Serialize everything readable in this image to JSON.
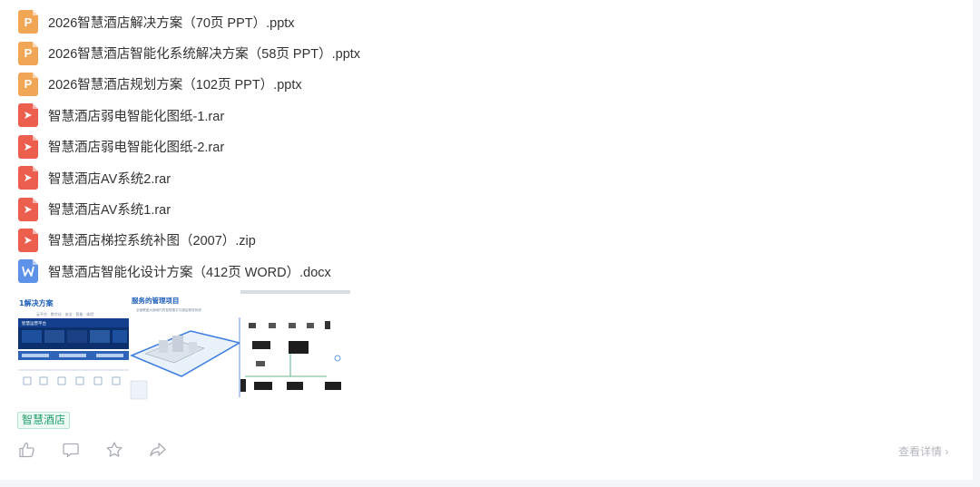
{
  "files": [
    {
      "name": "2026智慧酒店解决方案（70页 PPT）.pptx",
      "type": "ppt",
      "icon": "ppt-file-icon"
    },
    {
      "name": "2026智慧酒店智能化系统解决方案（58页 PPT）.pptx",
      "type": "ppt",
      "icon": "ppt-file-icon"
    },
    {
      "name": "2026智慧酒店规划方案（102页 PPT）.pptx",
      "type": "ppt",
      "icon": "ppt-file-icon"
    },
    {
      "name": "智慧酒店弱电智能化图纸-1.rar",
      "type": "rar",
      "icon": "archive-file-icon"
    },
    {
      "name": "智慧酒店弱电智能化图纸-2.rar",
      "type": "rar",
      "icon": "archive-file-icon"
    },
    {
      "name": "智慧酒店AV系统2.rar",
      "type": "rar",
      "icon": "archive-file-icon"
    },
    {
      "name": "智慧酒店AV系统1.rar",
      "type": "rar",
      "icon": "archive-file-icon"
    },
    {
      "name": "智慧酒店梯控系统补图（2007）.zip",
      "type": "rar",
      "icon": "archive-file-icon"
    },
    {
      "name": "智慧酒店智能化设计方案（412页 WORD）.docx",
      "type": "doc",
      "icon": "word-file-icon"
    }
  ],
  "thumbnails": {
    "thumb1": {
      "title": "1解决方案",
      "subtitle": "云平台 · 数字化 · 安全 · 智能 · 体验",
      "platform_label": "智慧运营平台"
    },
    "thumb2": {
      "title": "服务的管理项目",
      "subtitle": "全面覆盖大面域内的智慧楼宇与酒店服务系统"
    }
  },
  "tag": {
    "label": "智慧酒店"
  },
  "actions": {
    "like_icon": "thumbs-up-icon",
    "comment_icon": "comment-icon",
    "favorite_icon": "star-icon",
    "share_icon": "share-icon"
  },
  "detail_link": {
    "label": "查看详情 ›"
  },
  "colors": {
    "ppt": "#f1a656",
    "rar": "#ec5e4e",
    "doc": "#5e92e8",
    "tag_text": "#22a06b",
    "accent_blue": "#1e6fd9"
  }
}
